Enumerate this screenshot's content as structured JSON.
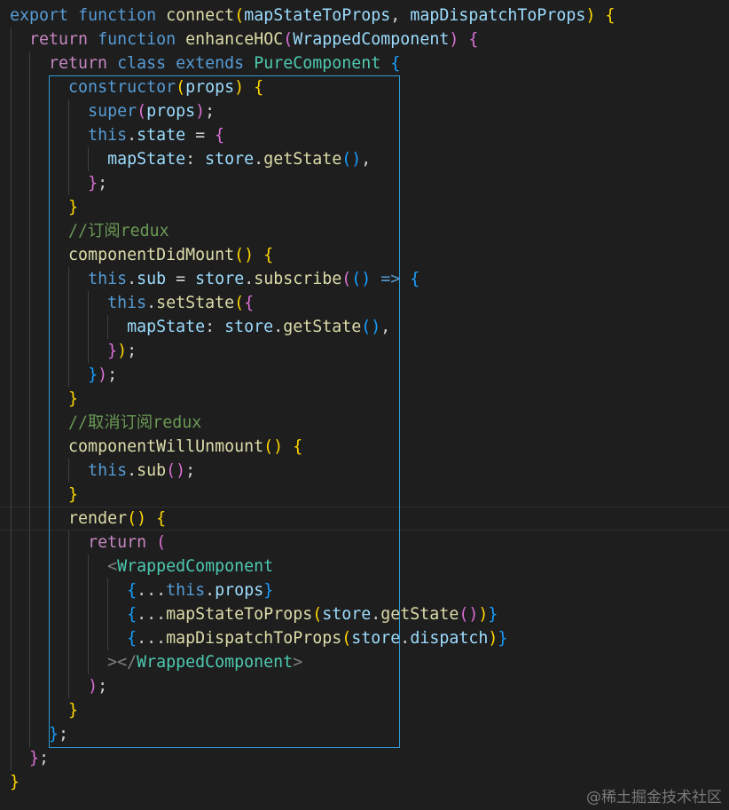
{
  "editor": {
    "theme": "dark",
    "background": "#1e1e1e",
    "colors": {
      "kw": "#c586c0",
      "stor": "#569cd6",
      "fn": "#dcdcaa",
      "var": "#9cdcfe",
      "cls": "#4ec9b0",
      "pun": "#d4d4d4",
      "b1": "#ffd700",
      "b2": "#da70d6",
      "b3": "#179fff",
      "com": "#6a9955",
      "tag": "#808080",
      "num": "#b5cea8"
    },
    "lines": [
      [
        [
          "stor",
          "export"
        ],
        [
          "pun",
          " "
        ],
        [
          "stor",
          "function"
        ],
        [
          "pun",
          " "
        ],
        [
          "fn",
          "connect"
        ],
        [
          "b1",
          "("
        ],
        [
          "var",
          "mapStateToProps"
        ],
        [
          "pun",
          ", "
        ],
        [
          "var",
          "mapDispatchToProps"
        ],
        [
          "b1",
          ")"
        ],
        [
          "pun",
          " "
        ],
        [
          "b1",
          "{"
        ]
      ],
      [
        [
          "pun",
          "  "
        ],
        [
          "kw",
          "return"
        ],
        [
          "pun",
          " "
        ],
        [
          "stor",
          "function"
        ],
        [
          "pun",
          " "
        ],
        [
          "fn",
          "enhanceHOC"
        ],
        [
          "b2",
          "("
        ],
        [
          "var",
          "WrappedComponent"
        ],
        [
          "b2",
          ")"
        ],
        [
          "pun",
          " "
        ],
        [
          "b2",
          "{"
        ]
      ],
      [
        [
          "pun",
          "    "
        ],
        [
          "kw",
          "return"
        ],
        [
          "pun",
          " "
        ],
        [
          "stor",
          "class"
        ],
        [
          "pun",
          " "
        ],
        [
          "stor",
          "extends"
        ],
        [
          "pun",
          " "
        ],
        [
          "cls",
          "PureComponent"
        ],
        [
          "pun",
          " "
        ],
        [
          "b3",
          "{"
        ]
      ],
      [
        [
          "pun",
          "      "
        ],
        [
          "stor",
          "constructor"
        ],
        [
          "b1",
          "("
        ],
        [
          "var",
          "props"
        ],
        [
          "b1",
          ")"
        ],
        [
          "pun",
          " "
        ],
        [
          "b1",
          "{"
        ]
      ],
      [
        [
          "pun",
          "        "
        ],
        [
          "stor",
          "super"
        ],
        [
          "b2",
          "("
        ],
        [
          "var",
          "props"
        ],
        [
          "b2",
          ")"
        ],
        [
          "pun",
          ";"
        ]
      ],
      [
        [
          "pun",
          "        "
        ],
        [
          "stor",
          "this"
        ],
        [
          "pun",
          "."
        ],
        [
          "var",
          "state"
        ],
        [
          "pun",
          " = "
        ],
        [
          "b2",
          "{"
        ]
      ],
      [
        [
          "pun",
          "          "
        ],
        [
          "var",
          "mapState"
        ],
        [
          "pun",
          ": "
        ],
        [
          "var",
          "store"
        ],
        [
          "pun",
          "."
        ],
        [
          "fn",
          "getState"
        ],
        [
          "b3",
          "()"
        ],
        [
          "pun",
          ","
        ]
      ],
      [
        [
          "pun",
          "        "
        ],
        [
          "b2",
          "}"
        ],
        [
          "pun",
          ";"
        ]
      ],
      [
        [
          "pun",
          "      "
        ],
        [
          "b1",
          "}"
        ]
      ],
      [
        [
          "pun",
          "      "
        ],
        [
          "com",
          "//订阅redux"
        ]
      ],
      [
        [
          "pun",
          "      "
        ],
        [
          "fn",
          "componentDidMount"
        ],
        [
          "b1",
          "()"
        ],
        [
          "pun",
          " "
        ],
        [
          "b1",
          "{"
        ]
      ],
      [
        [
          "pun",
          "        "
        ],
        [
          "stor",
          "this"
        ],
        [
          "pun",
          "."
        ],
        [
          "var",
          "sub"
        ],
        [
          "pun",
          " = "
        ],
        [
          "var",
          "store"
        ],
        [
          "pun",
          "."
        ],
        [
          "fn",
          "subscribe"
        ],
        [
          "b2",
          "("
        ],
        [
          "b3",
          "()"
        ],
        [
          "pun",
          " "
        ],
        [
          "stor",
          "=>"
        ],
        [
          "pun",
          " "
        ],
        [
          "b3",
          "{"
        ]
      ],
      [
        [
          "pun",
          "          "
        ],
        [
          "stor",
          "this"
        ],
        [
          "pun",
          "."
        ],
        [
          "fn",
          "setState"
        ],
        [
          "b1",
          "("
        ],
        [
          "b2",
          "{"
        ]
      ],
      [
        [
          "pun",
          "            "
        ],
        [
          "var",
          "mapState"
        ],
        [
          "pun",
          ": "
        ],
        [
          "var",
          "store"
        ],
        [
          "pun",
          "."
        ],
        [
          "fn",
          "getState"
        ],
        [
          "b3",
          "()"
        ],
        [
          "pun",
          ","
        ]
      ],
      [
        [
          "pun",
          "          "
        ],
        [
          "b2",
          "}"
        ],
        [
          "b1",
          ")"
        ],
        [
          "pun",
          ";"
        ]
      ],
      [
        [
          "pun",
          "        "
        ],
        [
          "b3",
          "}"
        ],
        [
          "b2",
          ")"
        ],
        [
          "pun",
          ";"
        ]
      ],
      [
        [
          "pun",
          "      "
        ],
        [
          "b1",
          "}"
        ]
      ],
      [
        [
          "pun",
          "      "
        ],
        [
          "com",
          "//取消订阅redux"
        ]
      ],
      [
        [
          "pun",
          "      "
        ],
        [
          "fn",
          "componentWillUnmount"
        ],
        [
          "b1",
          "()"
        ],
        [
          "pun",
          " "
        ],
        [
          "b1",
          "{"
        ]
      ],
      [
        [
          "pun",
          "        "
        ],
        [
          "stor",
          "this"
        ],
        [
          "pun",
          "."
        ],
        [
          "fn",
          "sub"
        ],
        [
          "b2",
          "()"
        ],
        [
          "pun",
          ";"
        ]
      ],
      [
        [
          "pun",
          "      "
        ],
        [
          "b1",
          "}"
        ]
      ],
      [
        [
          "pun",
          "      "
        ],
        [
          "fn",
          "render"
        ],
        [
          "b1",
          "()"
        ],
        [
          "pun",
          " "
        ],
        [
          "b1",
          "{"
        ]
      ],
      [
        [
          "pun",
          "        "
        ],
        [
          "kw",
          "return"
        ],
        [
          "pun",
          " "
        ],
        [
          "b2",
          "("
        ]
      ],
      [
        [
          "pun",
          "          "
        ],
        [
          "tag",
          "<"
        ],
        [
          "cls",
          "WrappedComponent"
        ]
      ],
      [
        [
          "pun",
          "            "
        ],
        [
          "b3",
          "{"
        ],
        [
          "pun",
          "..."
        ],
        [
          "stor",
          "this"
        ],
        [
          "pun",
          "."
        ],
        [
          "var",
          "props"
        ],
        [
          "b3",
          "}"
        ]
      ],
      [
        [
          "pun",
          "            "
        ],
        [
          "b3",
          "{"
        ],
        [
          "pun",
          "..."
        ],
        [
          "fn",
          "mapStateToProps"
        ],
        [
          "b1",
          "("
        ],
        [
          "var",
          "store"
        ],
        [
          "pun",
          "."
        ],
        [
          "fn",
          "getState"
        ],
        [
          "b2",
          "()"
        ],
        [
          "b1",
          ")"
        ],
        [
          "b3",
          "}"
        ]
      ],
      [
        [
          "pun",
          "            "
        ],
        [
          "b3",
          "{"
        ],
        [
          "pun",
          "..."
        ],
        [
          "fn",
          "mapDispatchToProps"
        ],
        [
          "b1",
          "("
        ],
        [
          "var",
          "store"
        ],
        [
          "pun",
          "."
        ],
        [
          "var",
          "dispatch"
        ],
        [
          "b1",
          ")"
        ],
        [
          "b3",
          "}"
        ]
      ],
      [
        [
          "pun",
          "          "
        ],
        [
          "tag",
          "></"
        ],
        [
          "cls",
          "WrappedComponent"
        ],
        [
          "tag",
          ">"
        ]
      ],
      [
        [
          "pun",
          "        "
        ],
        [
          "b2",
          ")"
        ],
        [
          "pun",
          ";"
        ]
      ],
      [
        [
          "pun",
          "      "
        ],
        [
          "b1",
          "}"
        ]
      ],
      [
        [
          "pun",
          "    "
        ],
        [
          "b3",
          "}"
        ],
        [
          "pun",
          ";"
        ]
      ],
      [
        [
          "pun",
          "  "
        ],
        [
          "b2",
          "}"
        ],
        [
          "pun",
          ";"
        ]
      ],
      [
        [
          "b1",
          "}"
        ]
      ]
    ]
  },
  "watermark": "@稀土掘金技术社区"
}
